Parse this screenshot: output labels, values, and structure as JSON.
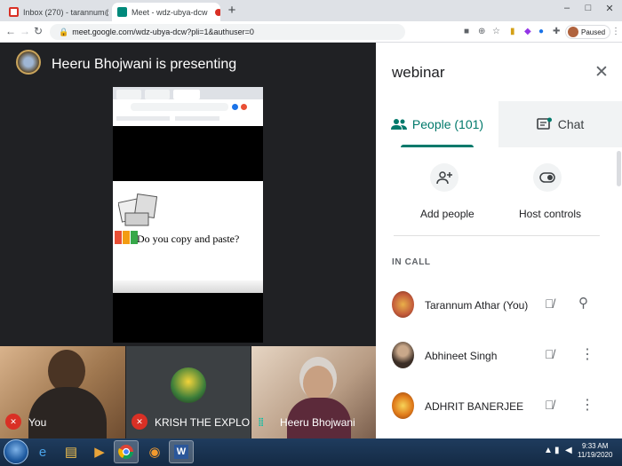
{
  "browser": {
    "tabs": [
      {
        "label": "Inbox (270) - tarannum@theindi",
        "color": "#d93025"
      },
      {
        "label": "Meet - wdz-ubya-dcw",
        "color": "#00897b"
      }
    ],
    "new_tab": "+",
    "window_controls": [
      "–",
      "□",
      "✕"
    ],
    "url": "meet.google.com/wdz-ubya-dcw?pli=1&authuser=0",
    "profile_status": "Paused"
  },
  "meeting": {
    "presenter_banner": "Heeru Bhojwani is presenting",
    "slide": {
      "text": "Do you copy and paste?",
      "bar_colors": [
        "#e94f35",
        "#f39c12",
        "#37a849"
      ]
    },
    "participant_tiles": [
      {
        "name": "You",
        "mic": "off"
      },
      {
        "name": "KRISH THE EXPLOR...",
        "mic": "off"
      },
      {
        "name": "Heeru Bhojwani",
        "mic": "speaking"
      }
    ]
  },
  "panel": {
    "title": "webinar",
    "tabs": {
      "people": "People (101)",
      "chat": "Chat"
    },
    "actions": {
      "add_people": "Add people",
      "host_controls": "Host controls"
    },
    "section_label": "IN CALL",
    "participants": [
      {
        "name": "Tarannum Athar (You)",
        "avatar_color": "#c25a3a"
      },
      {
        "name": "Abhineet Singh",
        "avatar_color": "#6b5a48"
      },
      {
        "name": "ADHRIT BANERJEE",
        "avatar_color": "#e07b1a"
      }
    ]
  },
  "taskbar": {
    "time": "9:33 AM",
    "date": "11/19/2020"
  },
  "colors": {
    "accent": "#00796b",
    "mic_off": "#d93025",
    "speaking": "#00bfa5"
  }
}
